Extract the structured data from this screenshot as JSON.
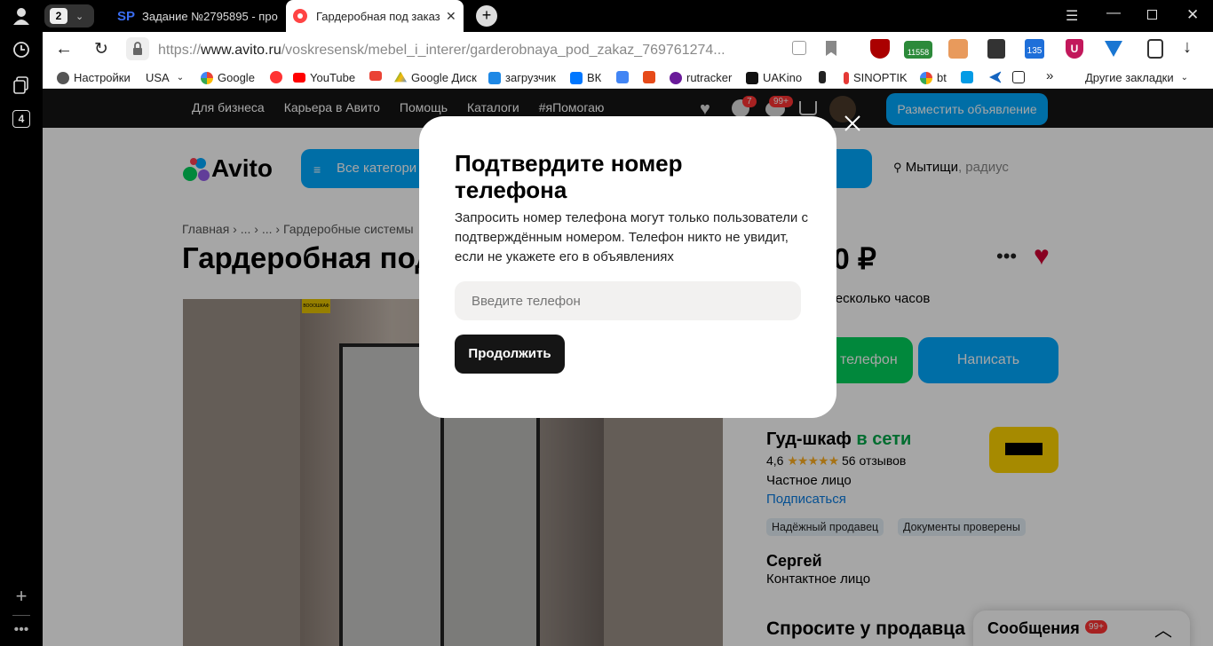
{
  "browser": {
    "tab_count": "2",
    "rail_badge": "4",
    "tabs": [
      {
        "favicon": "SP",
        "title": "Задание №2795895 - про"
      },
      {
        "favicon": "avito-dot",
        "title": "Гардеробная под заказ"
      }
    ],
    "url_prefix": "https://",
    "url_domain": "www.avito.ru",
    "url_path": "/voskresensk/mebel_i_interer/garderobnaya_pod_zakaz_769761274...",
    "ext_badge_1": "11558",
    "ext_badge_2": "135",
    "bookmarks": [
      {
        "label": "Настройки",
        "icon": "gear-icon"
      },
      {
        "label": "USA",
        "icon": "dropdown"
      },
      {
        "label": "Google",
        "icon": "google-icon"
      },
      {
        "label": "",
        "icon": "yandex-icon"
      },
      {
        "label": "YouTube",
        "icon": "youtube-icon"
      },
      {
        "label": "",
        "icon": "gmail-icon"
      },
      {
        "label": "Google Диск",
        "icon": "drive-icon"
      },
      {
        "label": "загрузчик",
        "icon": "loader-icon"
      },
      {
        "label": "ВК",
        "icon": "vk-icon"
      },
      {
        "label": "",
        "icon": "translate-icon"
      },
      {
        "label": "",
        "icon": "f-icon"
      },
      {
        "label": "rutracker",
        "icon": "rutracker-icon"
      },
      {
        "label": "UAKino",
        "icon": "uakino-icon"
      },
      {
        "label": "",
        "icon": "figure-icon"
      },
      {
        "label": "SINOPTIK",
        "icon": "thermometer-icon"
      },
      {
        "label": "bt",
        "icon": "google-icon"
      },
      {
        "label": "",
        "icon": "p-icon"
      },
      {
        "label": "",
        "icon": "arrow-icon"
      },
      {
        "label": "",
        "icon": "bc-icon"
      }
    ],
    "more_bookmarks": "»",
    "other_bookmarks": "Другие закладки"
  },
  "avito": {
    "topnav": [
      "Для бизнеса",
      "Карьера в Авито",
      "Помощь",
      "Каталоги",
      "#яПомогаю"
    ],
    "fav_badge": "7",
    "msg_badge": "99+",
    "post_ad_button": "Разместить объявление",
    "logo": "Avito",
    "all_categories": "Все категори",
    "search_button_tail": "ти",
    "location_city": "Мытищи",
    "location_radius": ", радиус",
    "breadcrumb": [
      "Главная",
      "...",
      "...",
      "Гардеробные системы"
    ],
    "title": "Гардеробная под",
    "price": "00 ₽",
    "reply_time": "а несколько часов",
    "phone_button": "телефон",
    "write_button": "Написать",
    "seller_name": "Гуд-шкаф",
    "seller_status": "в сети",
    "seller_rating": "4,6",
    "seller_reviews": "56 отзывов",
    "seller_type": "Частное лицо",
    "subscribe_link": "Подписаться",
    "badges": [
      "Надёжный продавец",
      "Документы проверены"
    ],
    "contact_name": "Сергей",
    "contact_role": "Контактное лицо",
    "ask_seller": "Спросите у продавца",
    "messages_panel": "Сообщения",
    "messages_badge": "99+",
    "photo_label": "ВОООШКАФ"
  },
  "modal": {
    "title": "Подтвердите номер телефона",
    "description": "Запросить номер телефона могут только пользователи с подтверждённым номером. Телефон никто не увидит, если не укажете его в объявлениях",
    "phone_placeholder": "Введите телефон",
    "continue_button": "Продолжить"
  },
  "colors": {
    "avito_blue": "#00aaff",
    "avito_green": "#02d15c",
    "heart_red": "#d10034",
    "dark": "#151515"
  }
}
